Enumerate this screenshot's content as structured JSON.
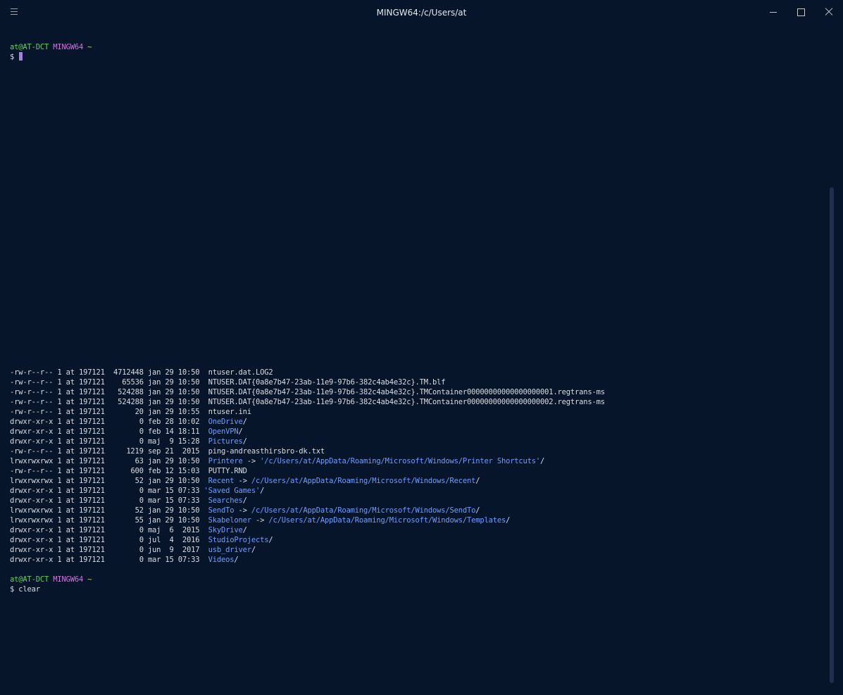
{
  "window": {
    "title": "MINGW64:/c/Users/at",
    "menu_icon": "hamburger-menu-icon",
    "min_icon": "minimize-icon",
    "max_icon": "maximize-icon",
    "close_icon": "close-icon"
  },
  "prompt1": {
    "user": "at@AT-DCT",
    "system": "MINGW64",
    "path": "~",
    "dollar": "$ "
  },
  "listing": [
    {
      "perm": "-rw-r--r--",
      "links": "1",
      "owner": "at",
      "group": "197121",
      "size": "4712448",
      "date": "jan 29 10:50",
      "sep": "  ",
      "name": "ntuser.dat.LOG2",
      "name_is_dir": false,
      "target": "",
      "suffix": ""
    },
    {
      "perm": "-rw-r--r--",
      "links": "1",
      "owner": "at",
      "group": "197121",
      "size": "65536",
      "date": "jan 29 10:50",
      "sep": "  ",
      "name": "NTUSER.DAT{0a8e7b47-23ab-11e9-97b6-382c4ab4e32c}.TM.blf",
      "name_is_dir": false,
      "target": "",
      "suffix": ""
    },
    {
      "perm": "-rw-r--r--",
      "links": "1",
      "owner": "at",
      "group": "197121",
      "size": "524288",
      "date": "jan 29 10:50",
      "sep": "  ",
      "name": "NTUSER.DAT{0a8e7b47-23ab-11e9-97b6-382c4ab4e32c}.TMContainer00000000000000000001.regtrans-ms",
      "name_is_dir": false,
      "target": "",
      "suffix": ""
    },
    {
      "perm": "-rw-r--r--",
      "links": "1",
      "owner": "at",
      "group": "197121",
      "size": "524288",
      "date": "jan 29 10:50",
      "sep": "  ",
      "name": "NTUSER.DAT{0a8e7b47-23ab-11e9-97b6-382c4ab4e32c}.TMContainer00000000000000000002.regtrans-ms",
      "name_is_dir": false,
      "target": "",
      "suffix": ""
    },
    {
      "perm": "-rw-r--r--",
      "links": "1",
      "owner": "at",
      "group": "197121",
      "size": "20",
      "date": "jan 29 10:55",
      "sep": "  ",
      "name": "ntuser.ini",
      "name_is_dir": false,
      "target": "",
      "suffix": ""
    },
    {
      "perm": "drwxr-xr-x",
      "links": "1",
      "owner": "at",
      "group": "197121",
      "size": "0",
      "date": "feb 28 10:02",
      "sep": "  ",
      "name": "OneDrive",
      "name_is_dir": true,
      "target": "",
      "suffix": "/"
    },
    {
      "perm": "drwxr-xr-x",
      "links": "1",
      "owner": "at",
      "group": "197121",
      "size": "0",
      "date": "feb 14 18:11",
      "sep": "  ",
      "name": "OpenVPN",
      "name_is_dir": true,
      "target": "",
      "suffix": "/"
    },
    {
      "perm": "drwxr-xr-x",
      "links": "1",
      "owner": "at",
      "group": "197121",
      "size": "0",
      "date": "maj  9 15:28",
      "sep": "  ",
      "name": "Pictures",
      "name_is_dir": true,
      "target": "",
      "suffix": "/"
    },
    {
      "perm": "-rw-r--r--",
      "links": "1",
      "owner": "at",
      "group": "197121",
      "size": "1219",
      "date": "sep 21  2015",
      "sep": "  ",
      "name": "ping-andreasthirsbro-dk.txt",
      "name_is_dir": false,
      "target": "",
      "suffix": ""
    },
    {
      "perm": "lrwxrwxrwx",
      "links": "1",
      "owner": "at",
      "group": "197121",
      "size": "63",
      "date": "jan 29 10:50",
      "sep": "  ",
      "name": "Printere",
      "name_is_dir": true,
      "target": "'/c/Users/at/AppData/Roaming/Microsoft/Windows/Printer Shortcuts'",
      "suffix": "/"
    },
    {
      "perm": "-rw-r--r--",
      "links": "1",
      "owner": "at",
      "group": "197121",
      "size": "600",
      "date": "feb 12 15:03",
      "sep": "  ",
      "name": "PUTTY.RND",
      "name_is_dir": false,
      "target": "",
      "suffix": ""
    },
    {
      "perm": "lrwxrwxrwx",
      "links": "1",
      "owner": "at",
      "group": "197121",
      "size": "52",
      "date": "jan 29 10:50",
      "sep": "  ",
      "name": "Recent",
      "name_is_dir": true,
      "target": "/c/Users/at/AppData/Roaming/Microsoft/Windows/Recent",
      "suffix": "/"
    },
    {
      "perm": "drwxr-xr-x",
      "links": "1",
      "owner": "at",
      "group": "197121",
      "size": "0",
      "date": "mar 15 07:33",
      "sep": " ",
      "name": "'Saved Games'",
      "name_is_dir": true,
      "target": "",
      "suffix": "/"
    },
    {
      "perm": "drwxr-xr-x",
      "links": "1",
      "owner": "at",
      "group": "197121",
      "size": "0",
      "date": "mar 15 07:33",
      "sep": "  ",
      "name": "Searches",
      "name_is_dir": true,
      "target": "",
      "suffix": "/"
    },
    {
      "perm": "lrwxrwxrwx",
      "links": "1",
      "owner": "at",
      "group": "197121",
      "size": "52",
      "date": "jan 29 10:50",
      "sep": "  ",
      "name": "SendTo",
      "name_is_dir": true,
      "target": "/c/Users/at/AppData/Roaming/Microsoft/Windows/SendTo",
      "suffix": "/"
    },
    {
      "perm": "lrwxrwxrwx",
      "links": "1",
      "owner": "at",
      "group": "197121",
      "size": "55",
      "date": "jan 29 10:50",
      "sep": "  ",
      "name": "Skabeloner",
      "name_is_dir": true,
      "target": "/c/Users/at/AppData/Roaming/Microsoft/Windows/Templates",
      "suffix": "/"
    },
    {
      "perm": "drwxr-xr-x",
      "links": "1",
      "owner": "at",
      "group": "197121",
      "size": "0",
      "date": "maj  6  2015",
      "sep": "  ",
      "name": "SkyDrive",
      "name_is_dir": true,
      "target": "",
      "suffix": "/"
    },
    {
      "perm": "drwxr-xr-x",
      "links": "1",
      "owner": "at",
      "group": "197121",
      "size": "0",
      "date": "jul  4  2016",
      "sep": "  ",
      "name": "StudioProjects",
      "name_is_dir": true,
      "target": "",
      "suffix": "/"
    },
    {
      "perm": "drwxr-xr-x",
      "links": "1",
      "owner": "at",
      "group": "197121",
      "size": "0",
      "date": "jun  9  2017",
      "sep": "  ",
      "name": "usb_driver",
      "name_is_dir": true,
      "target": "",
      "suffix": "/"
    },
    {
      "perm": "drwxr-xr-x",
      "links": "1",
      "owner": "at",
      "group": "197121",
      "size": "0",
      "date": "mar 15 07:33",
      "sep": "  ",
      "name": "Videos",
      "name_is_dir": true,
      "target": "",
      "suffix": "/"
    }
  ],
  "link_arrow": " -> ",
  "prompt2": {
    "user": "at@AT-DCT",
    "system": "MINGW64",
    "path": "~",
    "dollar": "$ ",
    "command": "clear"
  },
  "colors": {
    "background": "#061529",
    "user": "#5fd35f",
    "system": "#c97bd8",
    "path": "#e4c76a",
    "directory": "#6f9dff",
    "cursor": "#a87df0",
    "scrollbar": "#232d4c"
  }
}
